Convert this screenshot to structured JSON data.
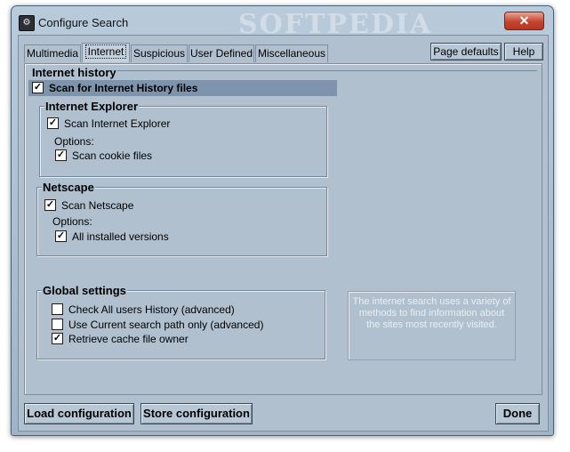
{
  "window": {
    "title": "Configure Search",
    "watermark": "SOFTPEDIA",
    "close_label": "✕"
  },
  "tabs": [
    {
      "label": "Multimedia"
    },
    {
      "label": "Internet"
    },
    {
      "label": "Suspicious"
    },
    {
      "label": "User Defined"
    },
    {
      "label": "Miscellaneous"
    }
  ],
  "header_buttons": {
    "page_defaults": "Page defaults",
    "help": "Help"
  },
  "internet_history": {
    "title": "Internet history",
    "scan_history": {
      "label": "Scan for Internet History files",
      "checked": "✓"
    }
  },
  "internet_explorer": {
    "title": "Internet Explorer",
    "scan_ie": {
      "label": "Scan Internet Explorer",
      "checked": "✓"
    },
    "options_label": "Options:",
    "scan_cookies": {
      "label": "Scan cookie files",
      "checked": "✓"
    }
  },
  "netscape": {
    "title": "Netscape",
    "scan_netscape": {
      "label": "Scan Netscape",
      "checked": "✓"
    },
    "options_label": "Options:",
    "all_versions": {
      "label": "All installed versions",
      "checked": "✓"
    }
  },
  "global_settings": {
    "title": "Global settings",
    "all_users": {
      "label": "Check All users History (advanced)",
      "checked": ""
    },
    "current_path": {
      "label": "Use Current search path only (advanced)",
      "checked": ""
    },
    "cache_owner": {
      "label": "Retrieve cache file owner",
      "checked": "✓"
    }
  },
  "info_text": "The internet search uses a variety of methods to find information about the sites most recently visited.",
  "bottom_buttons": {
    "load": "Load configuration",
    "store": "Store configuration",
    "done": "Done"
  }
}
